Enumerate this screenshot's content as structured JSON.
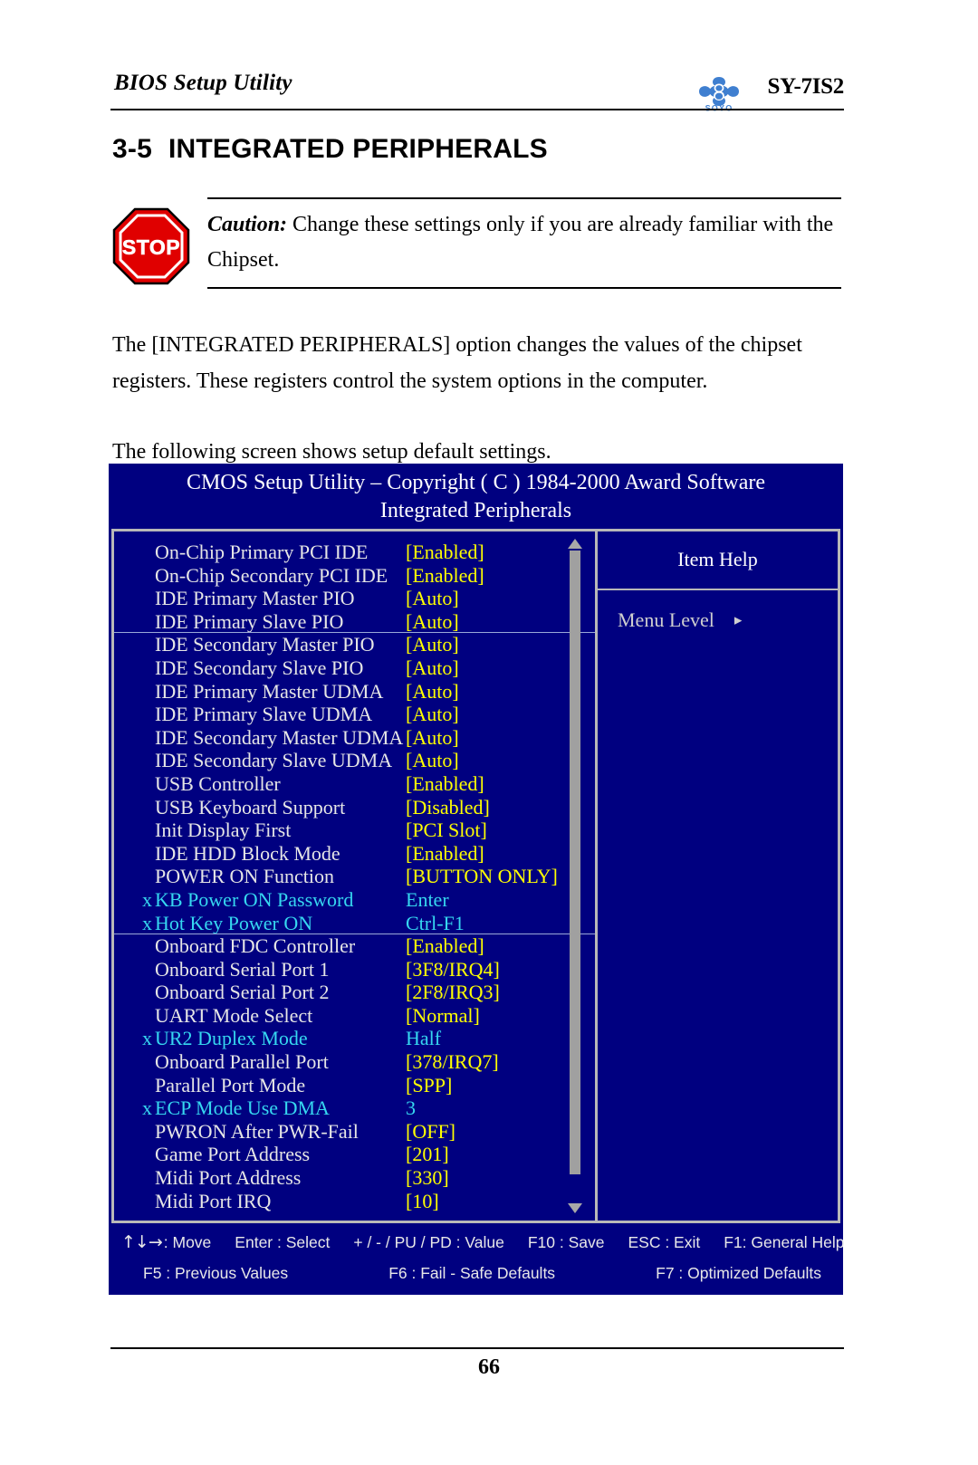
{
  "header": {
    "title": "BIOS Setup Utility",
    "model": "SY-7IS2",
    "logo_name": "soyo-logo",
    "logo_wordmark": "SOYO"
  },
  "section": {
    "number": "3-5",
    "title": "INTEGRATED PERIPHERALS"
  },
  "caution": {
    "icon_name": "stop-sign-icon",
    "icon_text": "STOP",
    "lead": "Caution:",
    "text": " Change these settings only if you are already familiar with the Chipset."
  },
  "paragraphs": {
    "p1": "The [INTEGRATED PERIPHERALS] option changes the values of the chipset registers. These registers control the system options in the computer.",
    "p2": "The following screen shows setup default settings."
  },
  "bios": {
    "title_line1": "CMOS Setup Utility – Copyright ( C ) 1984-2000 Award Software",
    "title_line2": "Integrated Peripherals",
    "help": {
      "title": "Item Help",
      "menu_level_label": "Menu Level",
      "menu_level_arrow": "▸"
    },
    "scrollbar": {
      "up_arrow": "▲",
      "down_arrow": "▼"
    },
    "settings": [
      {
        "prefix": "",
        "label": "On-Chip Primary      PCI IDE",
        "value": "[Enabled]",
        "dim": false,
        "sep": false
      },
      {
        "prefix": "",
        "label": "On-Chip Secondary PCI IDE",
        "value": "[Enabled]",
        "dim": false,
        "sep": false
      },
      {
        "prefix": "",
        "label": "IDE Primary Master PIO",
        "value": "[Auto]",
        "dim": false,
        "sep": false
      },
      {
        "prefix": "",
        "label": "IDE Primary Slave    PIO",
        "value": "[Auto]",
        "dim": false,
        "sep": true
      },
      {
        "prefix": "",
        "label": "IDE Secondary Master PIO",
        "value": "[Auto]",
        "dim": false,
        "sep": false
      },
      {
        "prefix": "",
        "label": "IDE Secondary Slave    PIO",
        "value": "[Auto]",
        "dim": false,
        "sep": false
      },
      {
        "prefix": "",
        "label": "IDE Primary Master UDMA",
        "value": "[Auto]",
        "dim": false,
        "sep": false
      },
      {
        "prefix": "",
        "label": "IDE Primary Slave     UDMA",
        "value": "[Auto]",
        "dim": false,
        "sep": false
      },
      {
        "prefix": "",
        "label": "IDE Secondary Master UDMA",
        "value": "[Auto]",
        "dim": false,
        "sep": false
      },
      {
        "prefix": "",
        "label": "IDE Secondary Slave   UDMA",
        "value": "[Auto]",
        "dim": false,
        "sep": false
      },
      {
        "prefix": "",
        "label": "USB Controller",
        "value": "[Enabled]",
        "dim": false,
        "sep": false
      },
      {
        "prefix": "",
        "label": "USB Keyboard Support",
        "value": "[Disabled]",
        "dim": false,
        "sep": false
      },
      {
        "prefix": "",
        "label": "Init Display First",
        "value": "[PCI Slot]",
        "dim": false,
        "sep": false
      },
      {
        "prefix": "",
        "label": "IDE HDD Block Mode",
        "value": "[Enabled]",
        "dim": false,
        "sep": false
      },
      {
        "prefix": "",
        "label": "POWER ON Function",
        "value": "[BUTTON ONLY]",
        "dim": false,
        "sep": false
      },
      {
        "prefix": "x",
        "label": "KB Power ON Password",
        "value": "Enter",
        "dim": true,
        "sep": false
      },
      {
        "prefix": "x",
        "label": "Hot Key Power ON",
        "value": "Ctrl-F1",
        "dim": true,
        "sep": true
      },
      {
        "prefix": "",
        "label": "Onboard FDC Controller",
        "value": "[Enabled]",
        "dim": false,
        "sep": false
      },
      {
        "prefix": "",
        "label": "Onboard Serial Port 1",
        "value": "[3F8/IRQ4]",
        "dim": false,
        "sep": false
      },
      {
        "prefix": "",
        "label": "Onboard Serial Port 2",
        "value": "[2F8/IRQ3]",
        "dim": false,
        "sep": false
      },
      {
        "prefix": "",
        "label": "UART Mode Select",
        "value": "[Normal]",
        "dim": false,
        "sep": false
      },
      {
        "prefix": "x",
        "label": "UR2 Duplex Mode",
        "value": "Half",
        "dim": true,
        "sep": false
      },
      {
        "prefix": "",
        "label": "Onboard Parallel Port",
        "value": "[378/IRQ7]",
        "dim": false,
        "sep": false
      },
      {
        "prefix": "",
        "label": "Parallel Port Mode",
        "value": "[SPP]",
        "dim": false,
        "sep": false
      },
      {
        "prefix": "x",
        "label": "ECP Mode Use DMA",
        "value": "3",
        "dim": true,
        "sep": false
      },
      {
        "prefix": "",
        "label": "PWRON After PWR-Fail",
        "value": "[OFF]",
        "dim": false,
        "sep": false
      },
      {
        "prefix": "",
        "label": "Game Port Address",
        "value": "[201]",
        "dim": false,
        "sep": false
      },
      {
        "prefix": "",
        "label": "Midi Port Address",
        "value": "[330]",
        "dim": false,
        "sep": false
      },
      {
        "prefix": "",
        "label": "Midi Port IRQ",
        "value": "[10]",
        "dim": false,
        "sep": false
      }
    ],
    "footer_row1": {
      "arrows": "↑↓→",
      "move": ": Move",
      "keys": [
        "Enter : Select",
        "+ / - / PU / PD : Value",
        "F10 : Save",
        "ESC : Exit",
        "F1: General Help"
      ]
    },
    "footer_row2": [
      "F5 : Previous Values",
      "F6 : Fail - Safe Defaults",
      "F7 : Optimized Defaults"
    ]
  },
  "page_number": "66",
  "colors": {
    "bios_background": "#000080",
    "value_yellow": "#ffff00",
    "dim_cyan": "#36d7f0",
    "frame_gray": "#b8b8b8",
    "stop_red": "#e00000",
    "logo_blue": "#3f7fd0"
  }
}
